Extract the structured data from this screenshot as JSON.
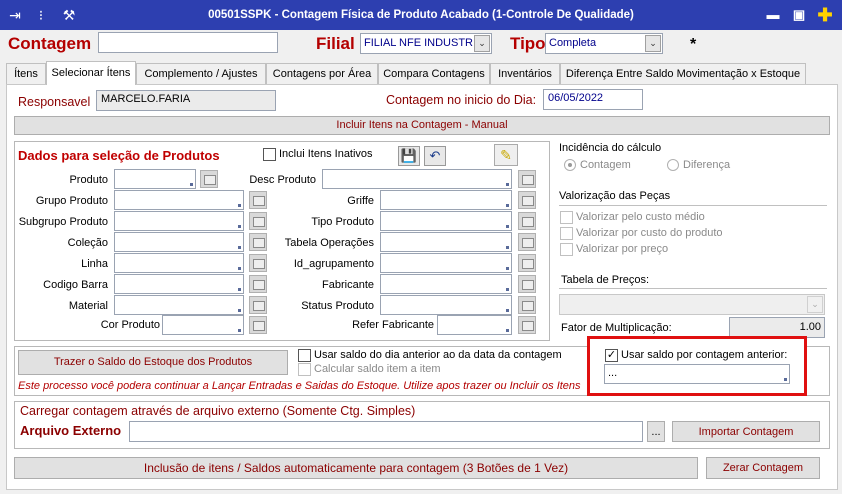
{
  "window": {
    "title": "00501SSPK - Contagem Física de Produto Acabado (1-Controle De Qualidade)",
    "toolbar_icons": [
      "exit-icon",
      "traffic-light-icon",
      "tools-icon"
    ],
    "controls": [
      "minimize-icon",
      "restore-icon",
      "plus-icon"
    ]
  },
  "header": {
    "contagem_label": "Contagem",
    "contagem_value": "",
    "filial_label": "Filial",
    "filial_value": "FILIAL NFE INDUSTRIA",
    "tipo_label": "Tipo",
    "tipo_value": "Completa",
    "asterisk": "*"
  },
  "tabs": [
    {
      "label": "Ítens"
    },
    {
      "label": "Selecionar Ítens"
    },
    {
      "label": "Complemento / Ajustes"
    },
    {
      "label": "Contagens por Área"
    },
    {
      "label": "Compara Contagens"
    },
    {
      "label": "Inventários"
    },
    {
      "label": "Diferença Entre Saldo Movimentação x Estoque"
    }
  ],
  "responsavel": {
    "label": "Responsavel",
    "value": "MARCELO.FARIA",
    "inicio_label": "Contagem no inicio do Dia:",
    "inicio_value": "06/05/2022"
  },
  "incluir_manual_button": "Incluir Itens na Contagem - Manual",
  "produtos": {
    "title": "Dados para seleção de Produtos",
    "inativos_label": "Inclui Itens Inativos",
    "left_fields": [
      "Produto",
      "Grupo Produto",
      "Subgrupo Produto",
      "Coleção",
      "Linha",
      "Codigo Barra",
      "Material",
      "Cor Produto"
    ],
    "right_fields": [
      "Desc Produto",
      "Griffe",
      "Tipo Produto",
      "Tabela Operações",
      "Id_agrupamento",
      "Fabricante",
      "Status Produto",
      "Refer Fabricante"
    ]
  },
  "incidencia": {
    "label": "Incidência do cálculo",
    "options": [
      "Contagem",
      "Diferença"
    ]
  },
  "valorizacao": {
    "label": "Valorização das Peças",
    "options": [
      "Valorizar pelo custo médio",
      "Valorizar por custo do produto",
      "Valorizar por preço"
    ]
  },
  "tabela_precos": {
    "label": "Tabela de Preços:",
    "value": ""
  },
  "fator": {
    "label": "Fator de Multiplicação:",
    "value": "1.00"
  },
  "saldo": {
    "button": "Trazer o Saldo do Estoque dos Produtos",
    "usar_dia_anterior": "Usar saldo do dia anterior ao da data da contagem",
    "calcular_item": "Calcular saldo item a item",
    "note": "Este processo você podera continuar a Lançar Entradas e Saidas do Estoque. Utilize apos trazer ou Incluir os Itens",
    "usar_contagem_anterior": "Usar saldo por contagem anterior:",
    "contagem_anterior_value": "..."
  },
  "arquivo": {
    "section_label": "Carregar contagem através de arquivo externo (Somente Ctg. Simples)",
    "label": "Arquivo Externo",
    "value": "",
    "browse": "...",
    "import_button": "Importar Contagem"
  },
  "footer": {
    "auto_button": "Inclusão de itens / Saldos automaticamente para contagem (3 Botões de 1 Vez)",
    "zerar_button": "Zerar Contagem"
  }
}
